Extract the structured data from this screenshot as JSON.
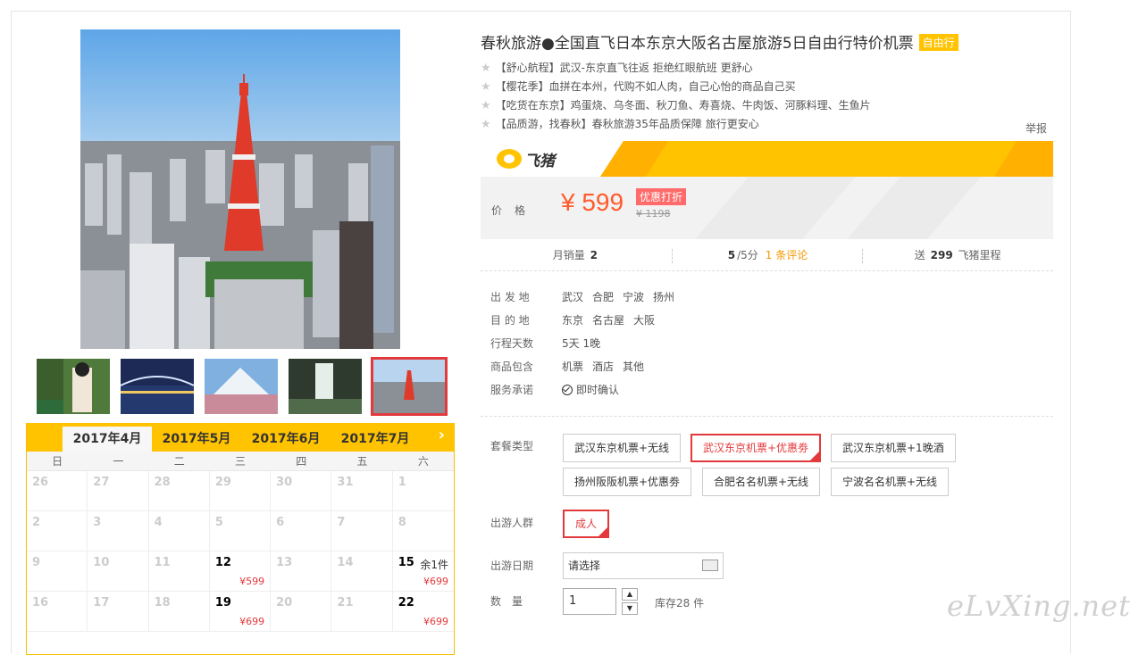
{
  "product": {
    "title": "春秋旅游●全国直飞日本东京大阪名古屋旅游5日自由行特价机票",
    "tag": "自由行",
    "features": [
      "【舒心航程】武汉-东京直飞往返 拒绝红眼航班 更舒心",
      "【樱花季】血拼在本州，代购不如人肉，自己心怡的商品自己买",
      "【吃货在东京】鸡蛋烧、乌冬面、秋刀鱼、寿喜烧、牛肉饭、河豚料理、生鱼片",
      "【品质游，找春秋】春秋旅游35年品质保障 旅行更安心"
    ],
    "report": "举报"
  },
  "brand": {
    "name": "飞猪"
  },
  "price": {
    "label": "价格",
    "current": "¥ 599",
    "discount_tag": "优惠打折",
    "original": "¥ 1198"
  },
  "stats": {
    "monthly_sales_label": "月销量",
    "monthly_sales": "2",
    "rating": "5",
    "rating_suffix": "/5分",
    "reviews": "1 条评论",
    "miles_prefix": "送",
    "miles": "299",
    "miles_suffix": "飞猪里程"
  },
  "info": {
    "departure_label": "出 发 地",
    "departures": [
      "武汉",
      "合肥",
      "宁波",
      "扬州"
    ],
    "destination_label": "目 的 地",
    "destinations": [
      "东京",
      "名古屋",
      "大阪"
    ],
    "days_label": "行程天数",
    "days": "5天 1晚",
    "includes_label": "商品包含",
    "includes": [
      "机票",
      "酒店",
      "其他"
    ],
    "promise_label": "服务承诺",
    "promise": "即时确认"
  },
  "options": {
    "package_label": "套餐类型",
    "packages": [
      "武汉东京机票+无线",
      "武汉东京机票+优惠劵",
      "武汉东京机票+1晚酒",
      "扬州阪阪机票+优惠劵",
      "合肥名名机票+无线",
      "宁波名名机票+无线"
    ],
    "selected_package": 1,
    "group_label": "出游人群",
    "group": "成人",
    "date_label": "出游日期",
    "date_placeholder": "请选择",
    "qty_label": "数　量",
    "qty": "1",
    "stock": "库存28 件"
  },
  "calendar": {
    "tabs": [
      "2017年4月",
      "2017年5月",
      "2017年6月",
      "2017年7月"
    ],
    "active_tab": 0,
    "weekdays": [
      "日",
      "一",
      "二",
      "三",
      "四",
      "五",
      "六"
    ],
    "cells": [
      {
        "d": "26"
      },
      {
        "d": "27"
      },
      {
        "d": "28"
      },
      {
        "d": "29"
      },
      {
        "d": "30"
      },
      {
        "d": "31"
      },
      {
        "d": "1"
      },
      {
        "d": "2"
      },
      {
        "d": "3"
      },
      {
        "d": "4"
      },
      {
        "d": "5"
      },
      {
        "d": "6"
      },
      {
        "d": "7"
      },
      {
        "d": "8"
      },
      {
        "d": "9"
      },
      {
        "d": "10"
      },
      {
        "d": "11"
      },
      {
        "d": "12",
        "price": "¥599"
      },
      {
        "d": "13"
      },
      {
        "d": "14"
      },
      {
        "d": "15",
        "stock": "余1件",
        "price": "¥699"
      },
      {
        "d": "16"
      },
      {
        "d": "17"
      },
      {
        "d": "18"
      },
      {
        "d": "19",
        "price": "¥699"
      },
      {
        "d": "20"
      },
      {
        "d": "21"
      },
      {
        "d": "22",
        "price": "¥699"
      }
    ]
  },
  "watermark": "eLvXing.net",
  "colors": {
    "accent": "#ffc300",
    "price": "#ff5a2a",
    "selected": "#e4393c"
  }
}
